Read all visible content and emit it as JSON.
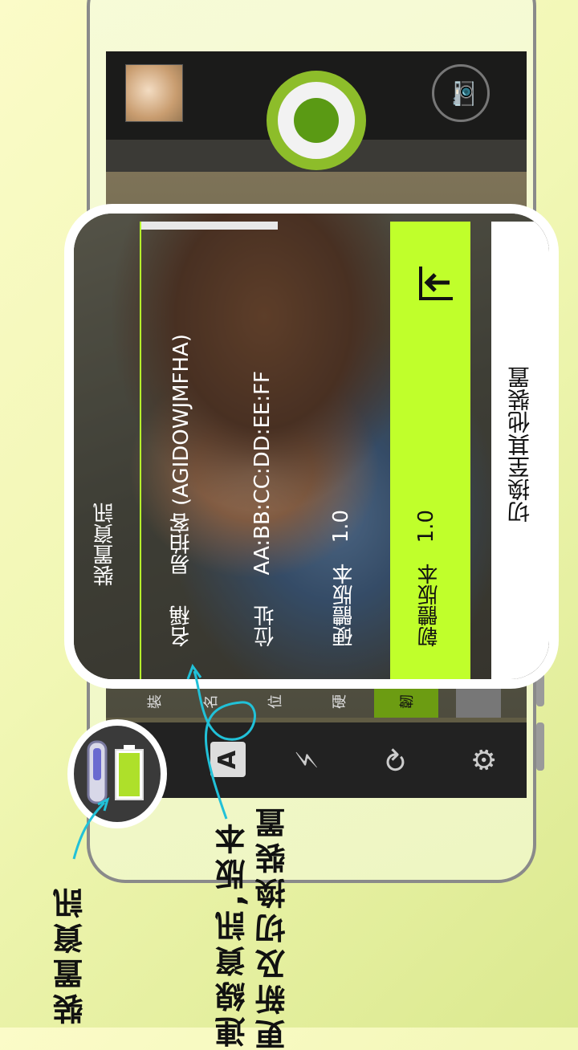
{
  "card": {
    "title": "裝置資訊",
    "name_label": "名稱",
    "name_value": "易拍客 (AGIDOWJMFHA)",
    "address_label": "位址",
    "address_value": "AA:BB:CC:DD:EE:FF",
    "hardware_label": "硬體版本",
    "hardware_value": "1.0",
    "firmware_label": "韌體版本",
    "firmware_value": "1.0",
    "switch_device": "切換至其他裝置"
  },
  "menu_strip": [
    "裝",
    "名",
    "位",
    "硬",
    "韌"
  ],
  "bottom_icons": {
    "auto_mode": "A"
  },
  "annotations": {
    "device_info": "裝置資訊",
    "connection_info_line1": "連線資訊,版本",
    "connection_info_line2": "更新及切換裝置"
  },
  "colors": {
    "accent_green": "#c0ff2b",
    "shutter_green": "#8dbd2a"
  }
}
